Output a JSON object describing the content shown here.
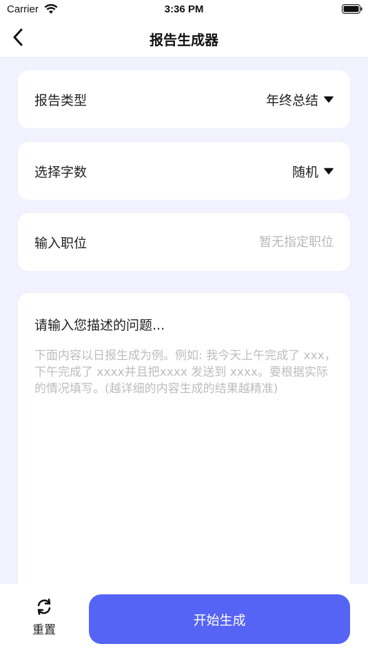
{
  "status_bar": {
    "carrier": "Carrier",
    "time": "3:36 PM"
  },
  "nav": {
    "title": "报告生成器",
    "back_icon": "chevron-left-icon"
  },
  "form": {
    "report_type": {
      "label": "报告类型",
      "value": "年终总结"
    },
    "word_count": {
      "label": "选择字数",
      "value": "随机"
    },
    "position": {
      "label": "输入职位",
      "placeholder": "暂无指定职位",
      "value": ""
    }
  },
  "description": {
    "title": "请输入您描述的问题...",
    "placeholder": "下面内容以日报生成为例。例如: 我今天上午完成了 xxx，下午完成了 xxxx并且把xxxx 发送到 xxxx。要根据实际的情况填写。(越详细的内容生成的结果越精准)"
  },
  "bottom": {
    "reset_label": "重置",
    "generate_label": "开始生成"
  },
  "colors": {
    "accent": "#5564f5",
    "background": "#f1f2fd"
  }
}
